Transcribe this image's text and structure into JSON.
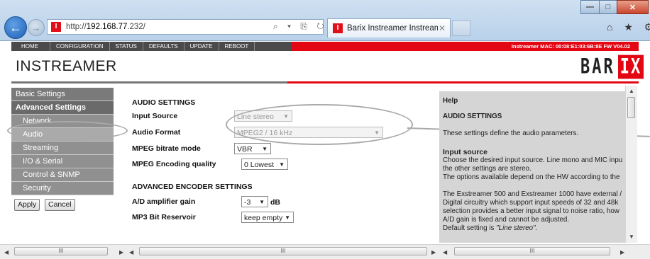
{
  "browser": {
    "url_prefix": "http://",
    "url_host": "192.168.77",
    "url_rest": ".232/",
    "addr_tools": "⌕ ▾ ⎘ ↻ ✕",
    "tab_title": "Barix Instreamer Instreamer",
    "tab_close": "✕",
    "favicon": "I",
    "right_icons": "⌂ ★ ⚙",
    "win_min": "—",
    "win_max": "□",
    "win_close": "✕"
  },
  "topnav": {
    "items": [
      "HOME",
      "CONFIGURATION",
      "STATUS",
      "DEFAULTS",
      "UPDATE",
      "REBOOT"
    ],
    "device_info": "Instreamer   MAC: 00:08:E1:03:6B:8E   FW V04.02"
  },
  "page": {
    "title": "INSTREAMER",
    "logo_left": "BAR",
    "logo_right": "IX"
  },
  "sidebar": {
    "items": [
      {
        "label": "Basic Settings"
      },
      {
        "label": "Advanced Settings"
      },
      {
        "label": "Network"
      },
      {
        "label": "Audio"
      },
      {
        "label": "Streaming"
      },
      {
        "label": "I/O & Serial"
      },
      {
        "label": "Control & SNMP"
      },
      {
        "label": "Security"
      }
    ],
    "apply_label": "Apply",
    "cancel_label": "Cancel"
  },
  "form": {
    "audio_settings_heading": "AUDIO SETTINGS",
    "input_source": {
      "label": "Input Source",
      "value": "Line stereo"
    },
    "audio_format": {
      "label": "Audio Format",
      "value": "MPEG2 / 16 kHz"
    },
    "mpeg_bitrate_mode": {
      "label": "MPEG bitrate mode",
      "value": "VBR"
    },
    "mpeg_encoding_quality": {
      "label": "MPEG Encoding quality",
      "value": "0 Lowest"
    },
    "advanced_heading": "ADVANCED ENCODER SETTINGS",
    "ad_gain": {
      "label": "A/D amplifier gain",
      "value": "-3",
      "unit": "dB"
    },
    "mp3_reservoir": {
      "label": "MP3 Bit Reservoir",
      "value": "keep empty"
    }
  },
  "help": {
    "title": "Help",
    "section": "AUDIO SETTINGS",
    "intro": "These settings define the audio parameters.",
    "input_source_heading": "Input source",
    "lines": [
      "Choose the desired input source. Line mono and MIC inpu",
      "the other settings are stereo.",
      "The options available depend on the HW according to the",
      "",
      "The Exstreamer 500 and Exstreamer 1000 have external /",
      "Digital circuitry which support input speeds of 32 and 48k",
      "selection provides a better input signal to noise ratio, how",
      "A/D gain is fixed and cannot be adjusted."
    ],
    "default_prefix": "Default setting is ",
    "default_value": "\"Line stereo\"."
  },
  "scrollbars": {
    "thumb_grip": "III",
    "left_arrow": "◀",
    "right_arrow": "▶",
    "up_arrow": "▲",
    "down_arrow": "▼"
  }
}
